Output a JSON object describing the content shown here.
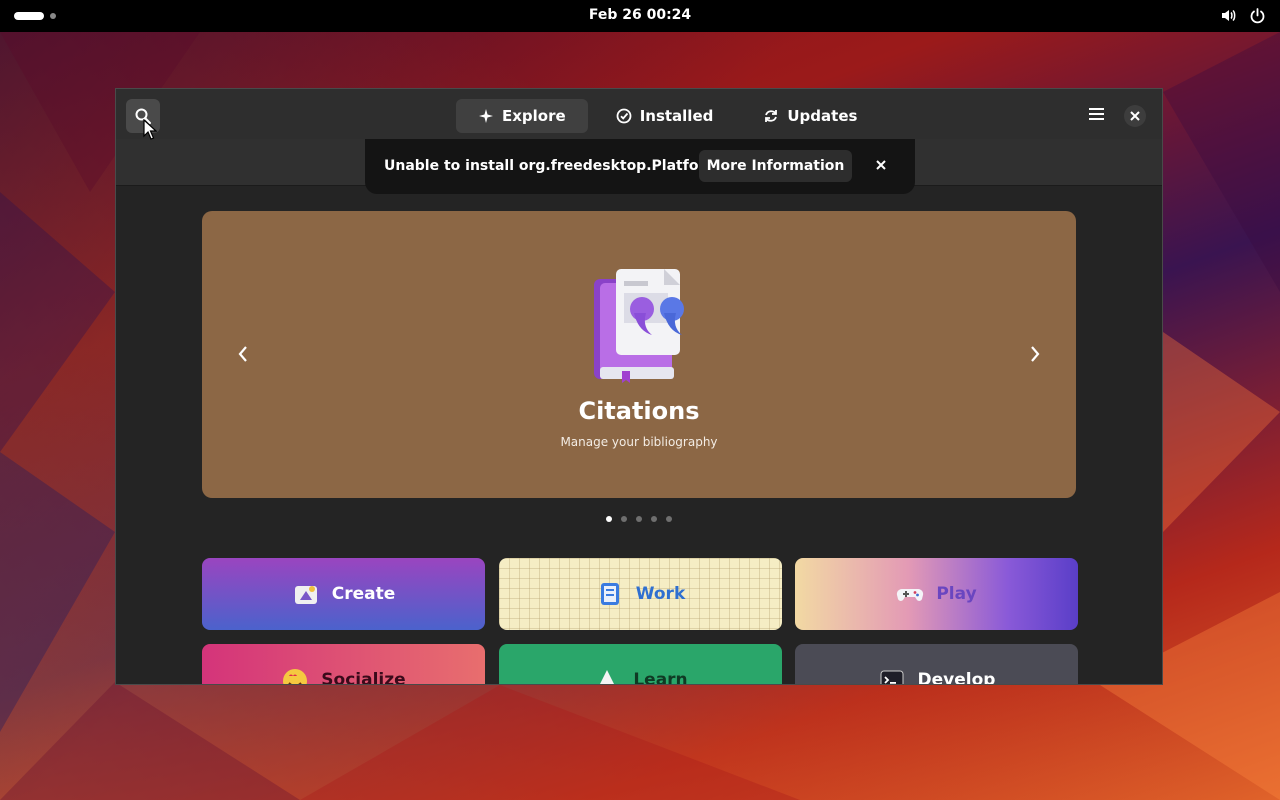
{
  "topbar": {
    "clock": "Feb 26  00:24"
  },
  "window": {
    "tabs": [
      {
        "label": "Explore",
        "icon": "sparkle-icon",
        "active": true
      },
      {
        "label": "Installed",
        "icon": "check-circle-icon",
        "active": false
      },
      {
        "label": "Updates",
        "icon": "refresh-icon",
        "active": false
      }
    ],
    "toast": {
      "message": "Unable to install org.freedesktop.Platform",
      "button": "More Information"
    },
    "banner": {
      "title": "Citations",
      "subtitle": "Manage your bibliography",
      "page_count": 5,
      "current_page": 1
    },
    "categories": [
      {
        "label": "Create",
        "icon": "create-icon"
      },
      {
        "label": "Work",
        "icon": "work-icon"
      },
      {
        "label": "Play",
        "icon": "gamepad-icon"
      },
      {
        "label": "Socialize",
        "icon": "smiley-icon"
      },
      {
        "label": "Learn",
        "icon": "learn-icon"
      },
      {
        "label": "Develop",
        "icon": "terminal-icon"
      }
    ]
  },
  "colors": {
    "banner_bg": "#8c6745",
    "window_bg": "#242424",
    "headerbar_bg": "#2e2e2e"
  }
}
